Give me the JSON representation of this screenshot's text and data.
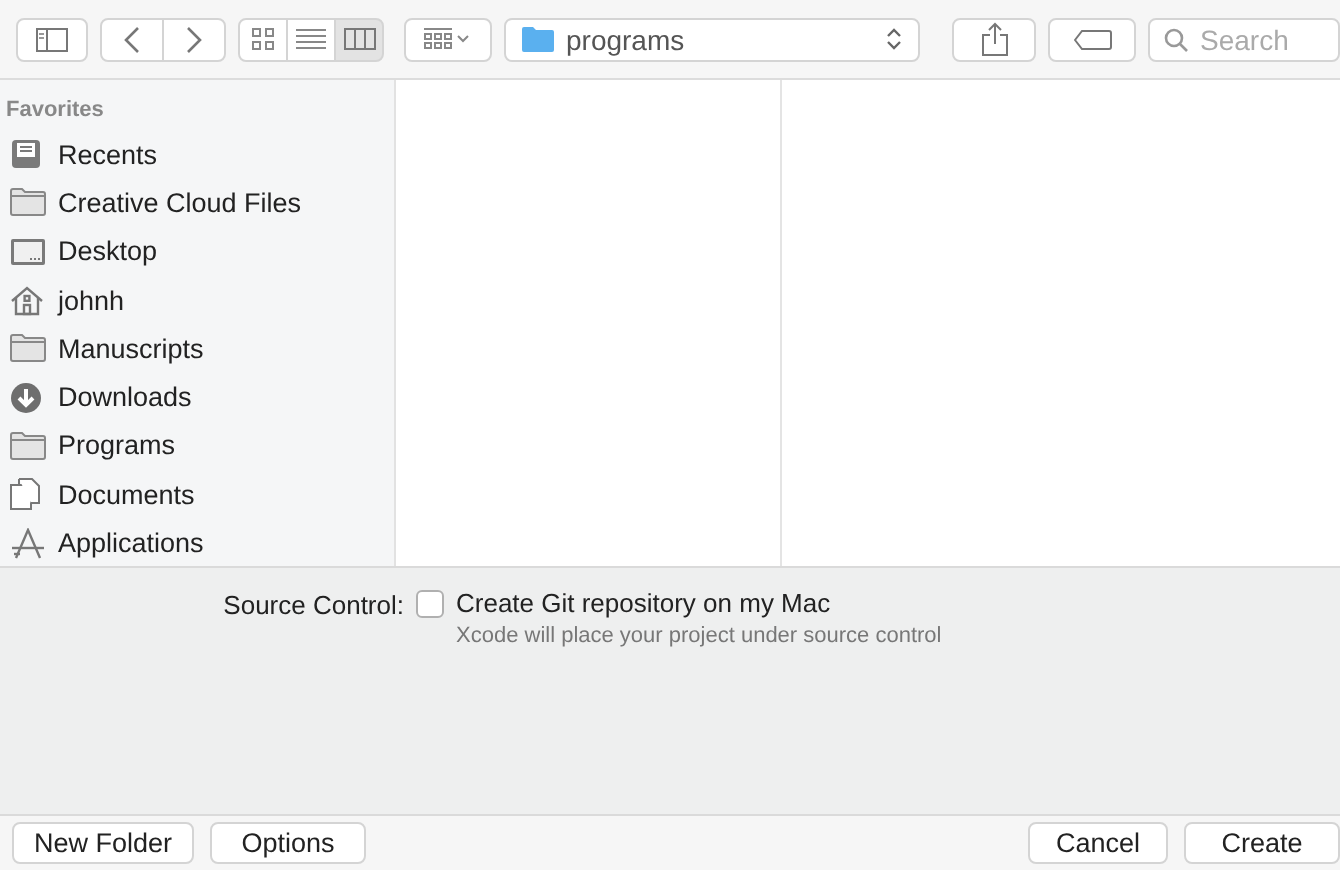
{
  "toolbar": {
    "view_modes": [
      {
        "kind": "icons",
        "selected": false
      },
      {
        "kind": "list",
        "selected": false
      },
      {
        "kind": "columns",
        "selected": true
      }
    ],
    "location": "programs",
    "search": {
      "placeholder": "Search"
    }
  },
  "sidebar": {
    "heading": "Favorites",
    "items": [
      {
        "label": "Recents",
        "kind": "recents"
      },
      {
        "label": "Creative Cloud Files",
        "kind": "folder"
      },
      {
        "label": "Desktop",
        "kind": "desktop"
      },
      {
        "label": "johnh",
        "kind": "home"
      },
      {
        "label": "Manuscripts",
        "kind": "folder"
      },
      {
        "label": "Downloads",
        "kind": "downloads"
      },
      {
        "label": "Programs",
        "kind": "folder"
      },
      {
        "label": "Documents",
        "kind": "documents"
      },
      {
        "label": "Applications",
        "kind": "applications"
      }
    ]
  },
  "source_control": {
    "label": "Source Control:",
    "checkbox": {
      "label": "Create Git repository on my Mac",
      "checked": false
    },
    "hint": "Xcode will place your project under source control"
  },
  "footer": {
    "left_buttons": [
      "New Folder",
      "Options"
    ],
    "right_buttons": [
      "Cancel",
      "Create"
    ]
  }
}
